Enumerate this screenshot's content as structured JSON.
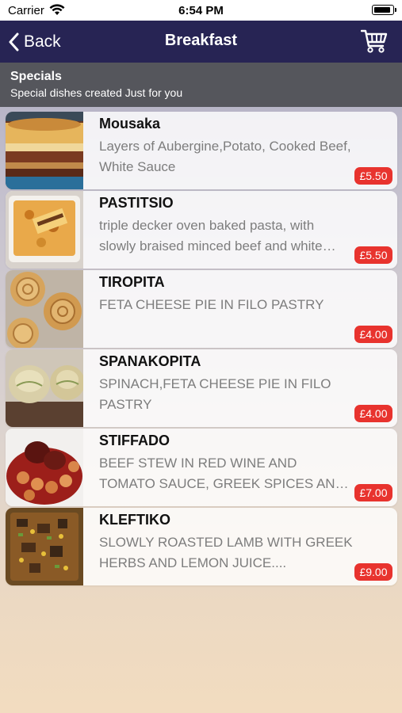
{
  "status_bar": {
    "carrier": "Carrier",
    "time": "6:54 PM",
    "battery_level": 0.9
  },
  "nav": {
    "back_label": "Back",
    "title": "Breakfast",
    "cart_icon": "cart-icon",
    "back_icon": "chevron-left-icon"
  },
  "section": {
    "title": "Specials",
    "subtitle": "Special dishes created Just for you"
  },
  "colors": {
    "nav_bg": "#272454",
    "section_bg": "#55565c",
    "price_badge": "#e8332e"
  },
  "dishes": [
    {
      "name": "Mousaka",
      "description": "Layers of Aubergine,Potato, Cooked Beef, White Sauce",
      "price": "£5.50"
    },
    {
      "name": "PASTITSIO",
      "description": "triple decker oven baked pasta, with slowly braised minced beef and white sauce",
      "price": "£5.50"
    },
    {
      "name": "TIROPITA",
      "description": "FETA CHEESE PIE IN FILO PASTRY",
      "price": "£4.00"
    },
    {
      "name": "SPANAKOPITA",
      "description": "SPINACH,FETA CHEESE PIE IN FILO PASTRY",
      "price": "£4.00"
    },
    {
      "name": "STIFFADO",
      "description": "BEEF STEW IN RED WINE AND TOMATO SAUCE, GREEK SPICES AND HERBS",
      "price": "£7.00"
    },
    {
      "name": "KLEFTIKO",
      "description": "SLOWLY ROASTED LAMB WITH GREEK HERBS AND LEMON JUICE....",
      "price": "£9.00"
    }
  ]
}
